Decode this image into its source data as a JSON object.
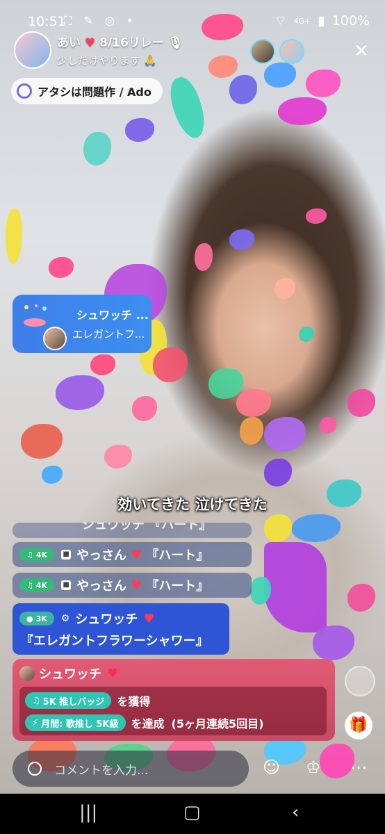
{
  "status_bar": {
    "time": "10:51",
    "left_icons": "⛶ ✎ ◎ •",
    "network": "4G+",
    "battery": "100%"
  },
  "host": {
    "name": "あい",
    "relay": "8/16リレー",
    "subtitle": "少しだけやります"
  },
  "song": {
    "label": "アタシは問題作 / Ado"
  },
  "gift_popup": {
    "title": "シュワッチ ...",
    "subtitle": "エレガントフ..."
  },
  "caption": "効いてきた 泣けてきた",
  "chat": [
    {
      "level": "4K",
      "user": "やっさん",
      "message": "『ハート』"
    },
    {
      "level": "4K",
      "user": "やっさん",
      "message": "『ハート』"
    }
  ],
  "partial_chat": {
    "text": "シュワッチ 『ハート』"
  },
  "gift_chat": {
    "level": "3K",
    "user": "シュワッチ",
    "message": "『エレガントフラワーシャワー』"
  },
  "achievement": {
    "user": "シュワッチ",
    "line1_badge": "5K 推しバッジ",
    "line1_text": "を獲得",
    "line2_badge": "月間: 歌推し 5K級",
    "line2_text": "を達成",
    "line2_note": "(5ヶ月連続5回目)"
  },
  "comment_input": {
    "placeholder": "コメントを入力..."
  },
  "icons": [
    "close-icon",
    "search-icon",
    "crown-icon",
    "more-icon",
    "gift-icon",
    "emoji-icon"
  ]
}
